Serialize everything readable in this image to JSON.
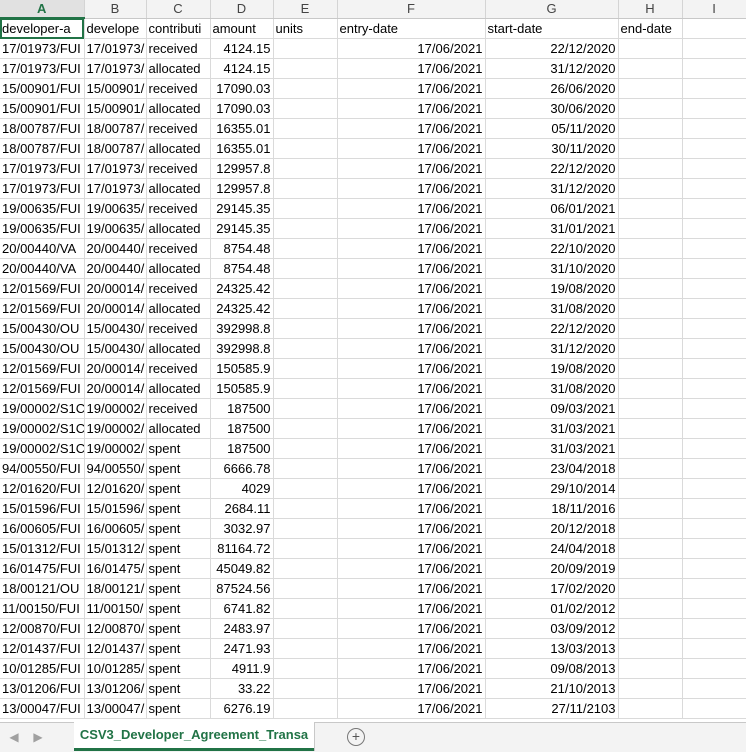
{
  "columns": [
    "A",
    "B",
    "C",
    "D",
    "E",
    "F",
    "G",
    "H",
    "I"
  ],
  "header_row": [
    "developer-a",
    "develope",
    "contributi",
    "amount",
    "units",
    "entry-date",
    "start-date",
    "end-date",
    ""
  ],
  "rows": [
    [
      "17/01973/FUI",
      "17/01973/",
      "received",
      "4124.15",
      "",
      "17/06/2021",
      "22/12/2020",
      "",
      ""
    ],
    [
      "17/01973/FUI",
      "17/01973/",
      "allocated",
      "4124.15",
      "",
      "17/06/2021",
      "31/12/2020",
      "",
      ""
    ],
    [
      "15/00901/FUI",
      "15/00901/",
      "received",
      "17090.03",
      "",
      "17/06/2021",
      "26/06/2020",
      "",
      ""
    ],
    [
      "15/00901/FUI",
      "15/00901/",
      "allocated",
      "17090.03",
      "",
      "17/06/2021",
      "30/06/2020",
      "",
      ""
    ],
    [
      "18/00787/FUI",
      "18/00787/",
      "received",
      "16355.01",
      "",
      "17/06/2021",
      "05/11/2020",
      "",
      ""
    ],
    [
      "18/00787/FUI",
      "18/00787/",
      "allocated",
      "16355.01",
      "",
      "17/06/2021",
      "30/11/2020",
      "",
      ""
    ],
    [
      "17/01973/FUI",
      "17/01973/",
      "received",
      "129957.8",
      "",
      "17/06/2021",
      "22/12/2020",
      "",
      ""
    ],
    [
      "17/01973/FUI",
      "17/01973/",
      "allocated",
      "129957.8",
      "",
      "17/06/2021",
      "31/12/2020",
      "",
      ""
    ],
    [
      "19/00635/FUI",
      "19/00635/",
      "received",
      "29145.35",
      "",
      "17/06/2021",
      "06/01/2021",
      "",
      ""
    ],
    [
      "19/00635/FUI",
      "19/00635/",
      "allocated",
      "29145.35",
      "",
      "17/06/2021",
      "31/01/2021",
      "",
      ""
    ],
    [
      "20/00440/VA",
      "20/00440/",
      "received",
      "8754.48",
      "",
      "17/06/2021",
      "22/10/2020",
      "",
      ""
    ],
    [
      "20/00440/VA",
      "20/00440/",
      "allocated",
      "8754.48",
      "",
      "17/06/2021",
      "31/10/2020",
      "",
      ""
    ],
    [
      "12/01569/FUI",
      "20/00014/",
      "received",
      "24325.42",
      "",
      "17/06/2021",
      "19/08/2020",
      "",
      ""
    ],
    [
      "12/01569/FUI",
      "20/00014/",
      "allocated",
      "24325.42",
      "",
      "17/06/2021",
      "31/08/2020",
      "",
      ""
    ],
    [
      "15/00430/OU",
      "15/00430/",
      "received",
      "392998.8",
      "",
      "17/06/2021",
      "22/12/2020",
      "",
      ""
    ],
    [
      "15/00430/OU",
      "15/00430/",
      "allocated",
      "392998.8",
      "",
      "17/06/2021",
      "31/12/2020",
      "",
      ""
    ],
    [
      "12/01569/FUI",
      "20/00014/",
      "received",
      "150585.9",
      "",
      "17/06/2021",
      "19/08/2020",
      "",
      ""
    ],
    [
      "12/01569/FUI",
      "20/00014/",
      "allocated",
      "150585.9",
      "",
      "17/06/2021",
      "31/08/2020",
      "",
      ""
    ],
    [
      "19/00002/S1C",
      "19/00002/",
      "received",
      "187500",
      "",
      "17/06/2021",
      "09/03/2021",
      "",
      ""
    ],
    [
      "19/00002/S1C",
      "19/00002/",
      "allocated",
      "187500",
      "",
      "17/06/2021",
      "31/03/2021",
      "",
      ""
    ],
    [
      "19/00002/S1C",
      "19/00002/",
      "spent",
      "187500",
      "",
      "17/06/2021",
      "31/03/2021",
      "",
      ""
    ],
    [
      "94/00550/FUI",
      "94/00550/",
      "spent",
      "6666.78",
      "",
      "17/06/2021",
      "23/04/2018",
      "",
      ""
    ],
    [
      "12/01620/FUI",
      "12/01620/",
      "spent",
      "4029",
      "",
      "17/06/2021",
      "29/10/2014",
      "",
      ""
    ],
    [
      "15/01596/FUI",
      "15/01596/",
      "spent",
      "2684.11",
      "",
      "17/06/2021",
      "18/11/2016",
      "",
      ""
    ],
    [
      "16/00605/FUI",
      "16/00605/",
      "spent",
      "3032.97",
      "",
      "17/06/2021",
      "20/12/2018",
      "",
      ""
    ],
    [
      "15/01312/FUI",
      "15/01312/",
      "spent",
      "81164.72",
      "",
      "17/06/2021",
      "24/04/2018",
      "",
      ""
    ],
    [
      "16/01475/FUI",
      "16/01475/",
      "spent",
      "45049.82",
      "",
      "17/06/2021",
      "20/09/2019",
      "",
      ""
    ],
    [
      "18/00121/OU",
      "18/00121/",
      "spent",
      "87524.56",
      "",
      "17/06/2021",
      "17/02/2020",
      "",
      ""
    ],
    [
      "11/00150/FUI",
      "11/00150/",
      "spent",
      "6741.82",
      "",
      "17/06/2021",
      "01/02/2012",
      "",
      ""
    ],
    [
      "12/00870/FUI",
      "12/00870/",
      "spent",
      "2483.97",
      "",
      "17/06/2021",
      "03/09/2012",
      "",
      ""
    ],
    [
      "12/01437/FUI",
      "12/01437/",
      "spent",
      "2471.93",
      "",
      "17/06/2021",
      "13/03/2013",
      "",
      ""
    ],
    [
      "10/01285/FUI",
      "10/01285/",
      "spent",
      "4911.9",
      "",
      "17/06/2021",
      "09/08/2013",
      "",
      ""
    ],
    [
      "13/01206/FUI",
      "13/01206/",
      "spent",
      "33.22",
      "",
      "17/06/2021",
      "21/10/2013",
      "",
      ""
    ],
    [
      "13/00047/FUI",
      "13/00047/",
      "spent",
      "6276.19",
      "",
      "17/06/2021",
      "27/11/2103",
      "",
      ""
    ]
  ],
  "sheet_tab": "CSV3_Developer_Agreement_Transa",
  "colors": {
    "accent": "#217346"
  },
  "icons": {
    "prev": "triangle-left-icon",
    "next": "triangle-right-icon",
    "add": "plus-circle-icon"
  }
}
